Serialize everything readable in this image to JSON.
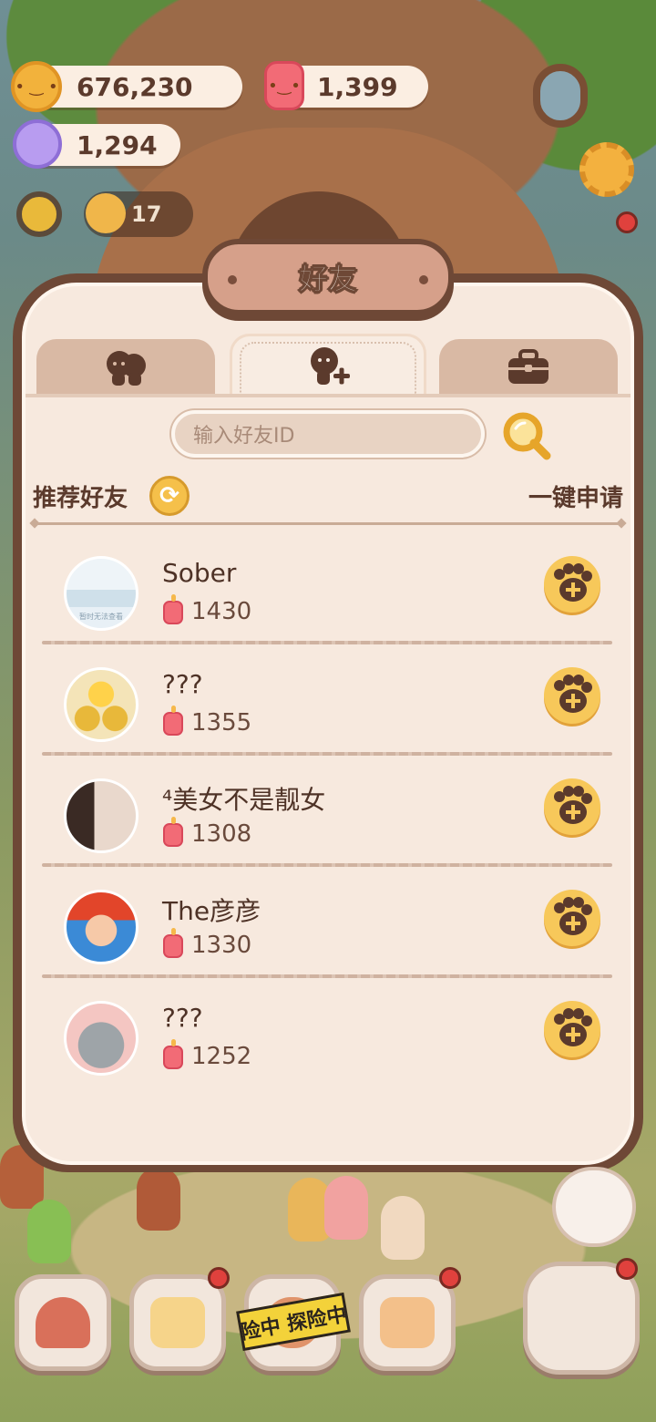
{
  "currencies": {
    "cookies": "676,230",
    "candles": "1,399",
    "candy": "1,294"
  },
  "hud": {
    "badge_count": "17"
  },
  "dialog": {
    "title": "好友",
    "tabs": [
      {
        "name": "friends-list",
        "icon": "two-people-icon"
      },
      {
        "name": "add-friend",
        "icon": "person-add-icon",
        "active": true
      },
      {
        "name": "gifts",
        "icon": "briefcase-icon"
      }
    ],
    "search": {
      "placeholder": "输入好友ID"
    },
    "recommend_label": "推荐好友",
    "apply_all_label": "一键申请",
    "friends": [
      {
        "name": "Sober",
        "score": "1430",
        "avatar_caption": "暂时无法查看"
      },
      {
        "name": "???",
        "score": "1355"
      },
      {
        "name": "⁴美女不是靓女",
        "score": "1308"
      },
      {
        "name": "The彦彦",
        "score": "1330"
      },
      {
        "name": "???",
        "score": "1252"
      }
    ]
  },
  "dock": {
    "tape_text": "险中 探险中"
  },
  "colors": {
    "panel_border": "#6e4836",
    "panel_bg": "#f7e9de",
    "accent_gold": "#f5c04a",
    "text_brown": "#5b3a2c"
  }
}
